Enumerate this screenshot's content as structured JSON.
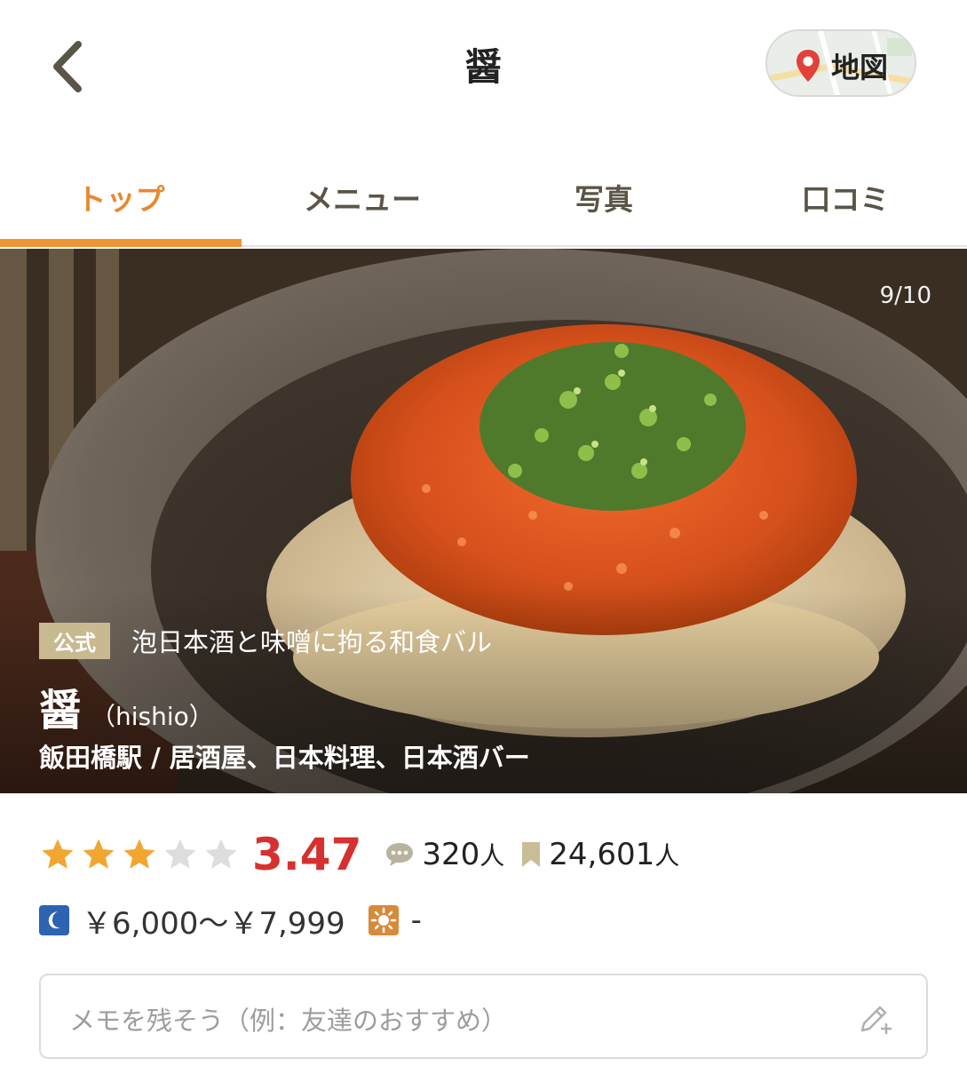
{
  "header": {
    "title": "醤",
    "map_label": "地図"
  },
  "tabs": [
    {
      "label": "トップ",
      "active": true
    },
    {
      "label": "メニュー",
      "active": false
    },
    {
      "label": "写真",
      "active": false
    },
    {
      "label": "口コミ",
      "active": false
    }
  ],
  "hero": {
    "counter": "9/10",
    "badge": "公式",
    "catch_copy": "泡日本酒と味噌に拘る和食バル",
    "shop_name": "醤",
    "shop_reading": "（hishio）",
    "genre": "飯田橋駅 / 居酒屋、日本料理、日本酒バー"
  },
  "rating": {
    "stars_filled": 3,
    "stars_total": 5,
    "score": "3.47",
    "reviews_count": "320",
    "reviews_unit": "人",
    "bookmarks_count": "24,601",
    "bookmarks_unit": "人"
  },
  "price": {
    "dinner": "￥6,000～￥7,999",
    "lunch": "-"
  },
  "memo": {
    "placeholder": "メモを残そう（例：友達のおすすめ）"
  },
  "colors": {
    "accent_orange": "#ec9532",
    "score_red": "#d6302f",
    "star_gold": "#f2a632",
    "star_gray": "#dddddd",
    "badge_beige": "#c9b990",
    "dinner_icon_blue": "#2d63b0",
    "lunch_icon_orange": "#d68a3a"
  },
  "icons": {
    "back": "chevron-left-icon",
    "map_pin": "map-pin-icon",
    "reviews": "speech-bubble-icon",
    "bookmark": "bookmark-icon",
    "dinner": "moon-icon",
    "lunch": "sun-icon",
    "memo_edit": "pencil-plus-icon"
  }
}
